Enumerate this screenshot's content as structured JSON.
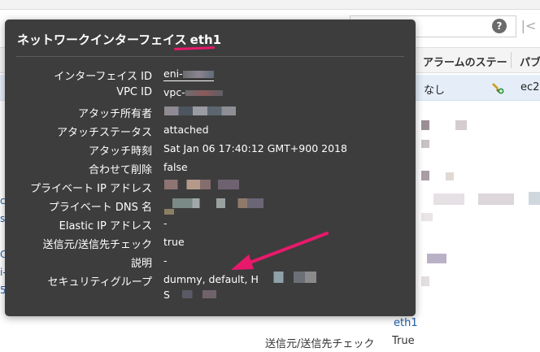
{
  "background": {
    "help_icon": "?",
    "first_page_icon": "|<",
    "columns": [
      "アラームのステー",
      "パブ"
    ],
    "row": {
      "alarm_status": "なし",
      "public_dns": "ec2-"
    },
    "left_links": [
      "c",
      "s",
      "C",
      "i-",
      "5"
    ],
    "eth_link": "eth1",
    "detail": {
      "label": "送信元/送信先チェック",
      "value": "True"
    }
  },
  "popover": {
    "title": "ネットワークインターフェイス",
    "title_eth": "eth1",
    "properties": [
      {
        "label": "インターフェイス ID",
        "value": "eni-"
      },
      {
        "label": "VPC ID",
        "value": "vpc-"
      },
      {
        "label": "アタッチ所有者",
        "value": ""
      },
      {
        "label": "アタッチステータス",
        "value": "attached"
      },
      {
        "label": "アタッチ時刻",
        "value": "Sat Jan 06 17:40:12 GMT+900 2018"
      },
      {
        "label": "合わせて削除",
        "value": "false"
      },
      {
        "label": "プライベート IP アドレス",
        "value": ""
      },
      {
        "label": "プライベート DNS 名",
        "value": ""
      },
      {
        "label": "Elastic IP アドレス",
        "value": "-"
      },
      {
        "label": "送信元/送信先チェック",
        "value": "true"
      },
      {
        "label": "説明",
        "value": "-"
      },
      {
        "label": "セキュリティグループ",
        "value": "dummy, default, H"
      }
    ],
    "security_group_line2": "S"
  },
  "colors": {
    "popover_bg": "#3d3d3d",
    "annotation_pink": "#e8196b",
    "selected_row": "#e5eef8",
    "link": "#1f5fa8"
  }
}
